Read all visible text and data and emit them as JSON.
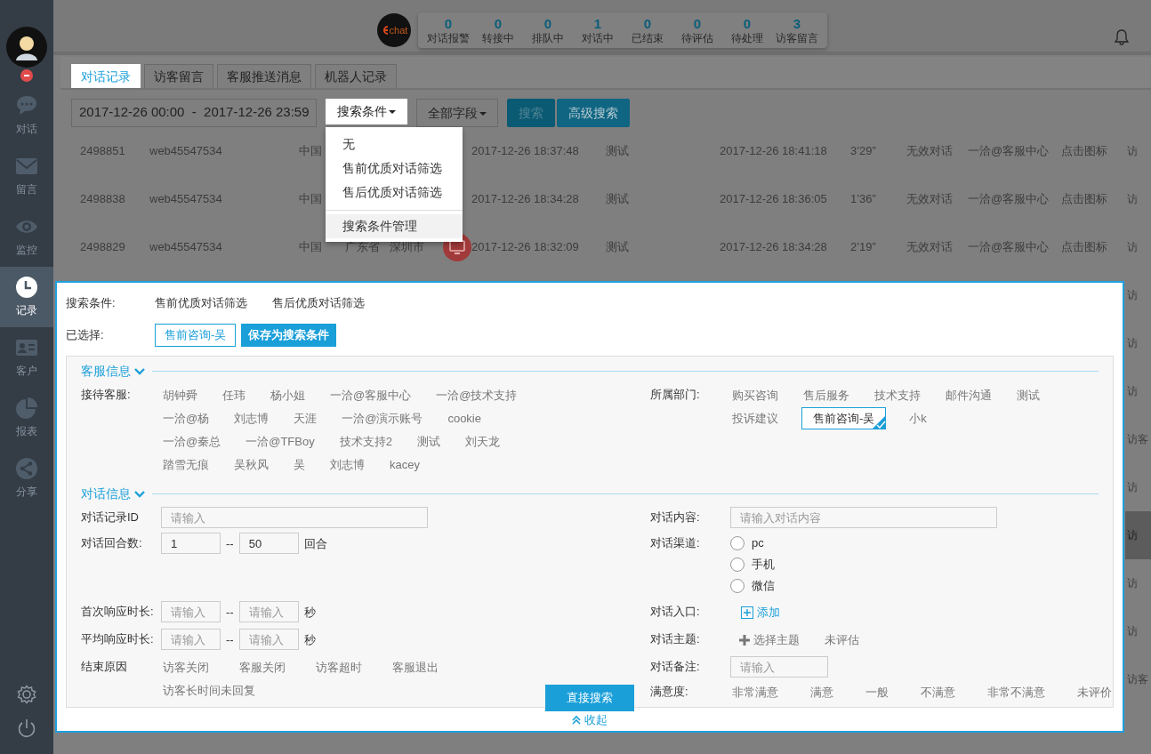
{
  "sidebar": {
    "busy": true,
    "items": [
      {
        "label": "对话",
        "selected": false
      },
      {
        "label": "留言",
        "selected": false
      },
      {
        "label": "监控",
        "selected": false
      },
      {
        "label": "记录",
        "selected": true
      },
      {
        "label": "客户",
        "selected": false
      },
      {
        "label": "报表",
        "selected": false
      },
      {
        "label": "分享",
        "selected": false
      }
    ]
  },
  "header": {
    "logo": "chat",
    "stats": [
      {
        "value": "0",
        "label": "对话报警"
      },
      {
        "value": "0",
        "label": "转接中"
      },
      {
        "value": "0",
        "label": "排队中"
      },
      {
        "value": "1",
        "label": "对话中"
      },
      {
        "value": "0",
        "label": "已结束"
      },
      {
        "value": "0",
        "label": "待评估"
      },
      {
        "value": "0",
        "label": "待处理"
      },
      {
        "value": "3",
        "label": "访客留言"
      }
    ]
  },
  "tabs": [
    {
      "label": "对话记录",
      "selected": true
    },
    {
      "label": "访客留言",
      "selected": false
    },
    {
      "label": "客服推送消息",
      "selected": false
    },
    {
      "label": "机器人记录",
      "selected": false
    }
  ],
  "toolbar": {
    "date_range": "2017-12-26 00:00  -  2017-12-26 23:59",
    "condition_button": "搜索条件",
    "field_button": "全部字段",
    "search_button": "搜索",
    "advanced_button": "高级搜索"
  },
  "dropdown": {
    "items": [
      {
        "label": "无",
        "kind": "option",
        "selected": false
      },
      {
        "label": "售前优质对话筛选",
        "kind": "option",
        "selected": false
      },
      {
        "label": "售后优质对话筛选",
        "kind": "option",
        "selected": false
      },
      {
        "label": "搜索条件管理",
        "kind": "action",
        "selected": true
      }
    ]
  },
  "table": {
    "rows": [
      {
        "selected": false,
        "id": "2498851",
        "visitor": "web45547534",
        "country": "中国",
        "start_time": "2017-12-26 18:37:48",
        "subject": "测试",
        "end_time": "2017-12-26 18:41:18",
        "duration": "3’29”",
        "result": "无效对话",
        "agent": "一洽@客服中心",
        "entry": "点击图标",
        "column_14": "访"
      },
      {
        "selected": false,
        "id": "2498838",
        "visitor": "web45547534",
        "country": "中国",
        "start_time": "2017-12-26 18:34:28",
        "subject": "测试",
        "end_time": "2017-12-26 18:36:05",
        "duration": "1’36”",
        "result": "无效对话",
        "agent": "一洽@客服中心",
        "entry": "点击图标",
        "column_14": "访"
      },
      {
        "selected": false,
        "id": "2498829",
        "visitor": "web45547534",
        "country": "中国",
        "province": "广东省",
        "city": "深圳市",
        "device_icon": true,
        "start_time": "2017-12-26 18:32:09",
        "subject": "测试",
        "end_time": "2017-12-26 18:34:28",
        "duration": "2’19”",
        "result": "无效对话",
        "agent": "一洽@客服中心",
        "entry": "点击图标",
        "column_14": "访"
      },
      {
        "selected": false,
        "column_14": "访"
      },
      {
        "selected": false,
        "column_14": "访"
      },
      {
        "selected": false,
        "column_14": "访"
      },
      {
        "selected": false,
        "column_14": "访客"
      },
      {
        "selected": false,
        "column_14": "访"
      },
      {
        "selected": true,
        "column_14": "访"
      },
      {
        "selected": false,
        "column_14": "访"
      },
      {
        "selected": false,
        "column_14": "访"
      },
      {
        "selected": false,
        "column_14": "访客"
      }
    ]
  },
  "panel": {
    "conditions_label": "搜索条件:",
    "conditions": [
      "售前优质对话筛选",
      "售后优质对话筛选"
    ],
    "selected_label": "已选择:",
    "selected_tags": [
      "售前咨询-吴"
    ],
    "save_button": "保存为搜索条件",
    "agent_info": {
      "title": "客服信息",
      "expanded": true,
      "agents_label": "接待客服:",
      "agents": [
        {
          "name": "胡钟舜",
          "selected": false
        },
        {
          "name": "任玮",
          "selected": false
        },
        {
          "name": "杨小姐",
          "selected": false
        },
        {
          "name": "一洽@客服中心",
          "selected": false
        },
        {
          "name": "一洽@技术支持",
          "selected": false
        },
        {
          "name": "一洽@杨",
          "selected": false
        },
        {
          "name": "刘志博",
          "selected": false
        },
        {
          "name": "天涯",
          "selected": false
        },
        {
          "name": "一洽@演示账号",
          "selected": false
        },
        {
          "name": "cookie",
          "selected": false
        },
        {
          "name": "一洽@秦总",
          "selected": false
        },
        {
          "name": "一洽@TFBoy",
          "selected": false
        },
        {
          "name": "技术支持2",
          "selected": false
        },
        {
          "name": "测试",
          "selected": false
        },
        {
          "name": "刘天龙",
          "selected": false
        },
        {
          "name": "踏雪无痕",
          "selected": false
        },
        {
          "name": "吴秋风",
          "selected": false
        },
        {
          "name": "吴",
          "selected": false
        },
        {
          "name": "刘志博",
          "selected": false
        },
        {
          "name": "kacey",
          "selected": false
        }
      ],
      "departments_label": "所属部门:",
      "departments": [
        {
          "name": "购买咨询",
          "selected": false
        },
        {
          "name": "售后服务",
          "selected": false
        },
        {
          "name": "技术支持",
          "selected": false
        },
        {
          "name": "邮件沟通",
          "selected": false
        },
        {
          "name": "测试",
          "selected": false
        },
        {
          "name": "投诉建议",
          "selected": false
        },
        {
          "name": "售前咨询-吴",
          "selected": true
        },
        {
          "name": "小k",
          "selected": false
        }
      ]
    },
    "chat_info": {
      "title": "对话信息",
      "expanded": true,
      "id_label": "对话记录ID",
      "id_placeholder": "请输入",
      "rounds_label": "对话回合数:",
      "rounds_from": "1",
      "rounds_separator": "--",
      "rounds_to": "50",
      "rounds_unit": "回合",
      "first_label": "首次响应时长:",
      "first_from_placeholder": "请输入",
      "first_separator": "--",
      "first_to_placeholder": "请输入",
      "first_unit": "秒",
      "avg_label": "平均响应时长:",
      "avg_from_placeholder": "请输入",
      "avg_separator": "--",
      "avg_to_placeholder": "请输入",
      "avg_unit": "秒",
      "end_label": "结束原因",
      "end_reasons": [
        {
          "label": "访客关闭",
          "selected": false
        },
        {
          "label": "客服关闭",
          "selected": false
        },
        {
          "label": "访客超时",
          "selected": false
        },
        {
          "label": "客服退出",
          "selected": false
        },
        {
          "label": "访客长时间未回复",
          "selected": false
        }
      ],
      "content_label": "对话内容:",
      "content_placeholder": "请输入对话内容",
      "channel_label": "对话渠道:",
      "channels": [
        {
          "label": "pc",
          "checked": false
        },
        {
          "label": "手机",
          "checked": false
        },
        {
          "label": "微信",
          "checked": false
        }
      ],
      "entry_label": "对话入口:",
      "entry_add": "添加",
      "topic_label": "对话主题:",
      "topic_select": "选择主题",
      "topic_value": "未评估",
      "note_label": "对话备注:",
      "note_placeholder": "请输入",
      "rating_label": "满意度:",
      "ratings": [
        {
          "label": "非常满意",
          "selected": false
        },
        {
          "label": "满意",
          "selected": false
        },
        {
          "label": "一般",
          "selected": false
        },
        {
          "label": "不满意",
          "selected": false
        },
        {
          "label": "非常不满意",
          "selected": false
        },
        {
          "label": "未评价",
          "selected": false
        }
      ]
    },
    "direct_search_button": "直接搜索",
    "collapse_link": "收起"
  }
}
